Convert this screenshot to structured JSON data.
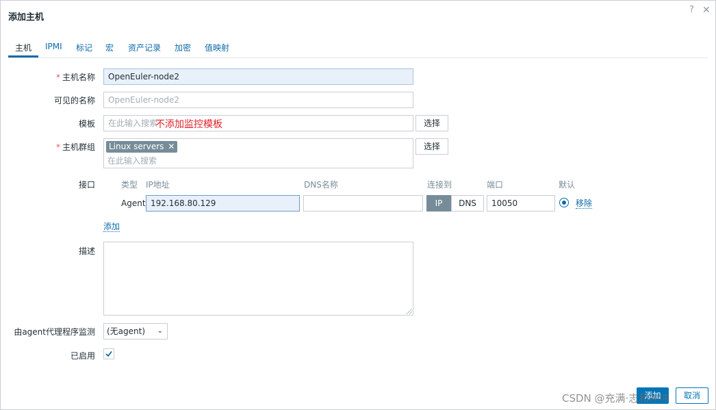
{
  "dialog": {
    "title": "添加主机",
    "help_icon": "question-mark-icon",
    "close_icon": "close-icon"
  },
  "tabs": [
    "主机",
    "IPMI",
    "标记",
    "宏",
    "资产记录",
    "加密",
    "值映射"
  ],
  "active_tab": "主机",
  "form": {
    "host_name": {
      "label": "主机名称",
      "required_mark": "*",
      "value": "OpenEuler-node2"
    },
    "visible_name": {
      "label": "可见的名称",
      "placeholder": "OpenEuler-node2"
    },
    "templates": {
      "label": "模板",
      "placeholder": "在此输入搜索",
      "select_button": "选择",
      "annotation": "不添加监控模板"
    },
    "host_groups": {
      "label": "主机群组",
      "required_mark": "*",
      "chip": "Linux servers",
      "chip_remove": "✕",
      "placeholder": "在此输入搜索",
      "select_button": "选择"
    },
    "interfaces": {
      "label": "接口",
      "columns": {
        "type": "类型",
        "ip": "IP地址",
        "dns": "DNS名称",
        "connect_to": "连接到",
        "port": "端口",
        "default": "默认"
      },
      "row": {
        "type": "Agent",
        "ip": "192.168.80.129",
        "dns": "",
        "connect_ip": "IP",
        "connect_dns": "DNS",
        "connect_selected": "IP",
        "port": "10050",
        "remove": "移除"
      },
      "add": "添加"
    },
    "description": {
      "label": "描述",
      "value": ""
    },
    "monitored_by_proxy": {
      "label": "由agent代理程序监测",
      "value": "(无agent)"
    },
    "enabled": {
      "label": "已启用",
      "checked": true
    }
  },
  "footer": {
    "add_button": "添加",
    "cancel_button": "取消"
  },
  "watermark": "CSDN @充满·志和冲冲"
}
